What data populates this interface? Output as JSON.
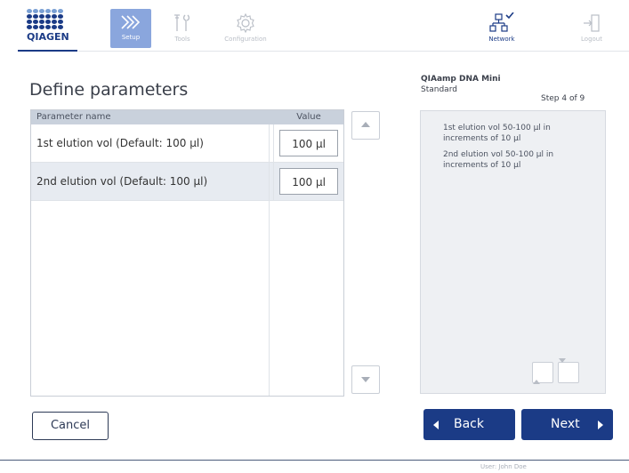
{
  "header": {
    "logo_text": "QIAGEN",
    "nav": {
      "setup": "Setup",
      "tools": "Tools",
      "configuration": "Configuration",
      "network": "Network",
      "logout": "Logout"
    },
    "accent_color": "#1b3b86",
    "active_tab_color": "#8aa6dd"
  },
  "main": {
    "title": "Define parameters",
    "table": {
      "headers": {
        "name": "Parameter name",
        "value": "Value"
      },
      "rows": [
        {
          "name": "1st elution vol (Default: 100 µl)",
          "value": "100 µl"
        },
        {
          "name": "2nd elution vol (Default: 100 µl)",
          "value": "100 µl"
        }
      ]
    }
  },
  "side": {
    "protocol": "QIAamp DNA Mini",
    "mode": "Standard",
    "step": "Step 4 of 9",
    "info": [
      "1st elution vol 50-100 µl in increments of 10 µl",
      "2nd elution vol 50-100 µl in increments of 10 µl"
    ]
  },
  "footer": {
    "cancel": "Cancel",
    "back": "Back",
    "next": "Next",
    "user": "User: John Doe"
  }
}
